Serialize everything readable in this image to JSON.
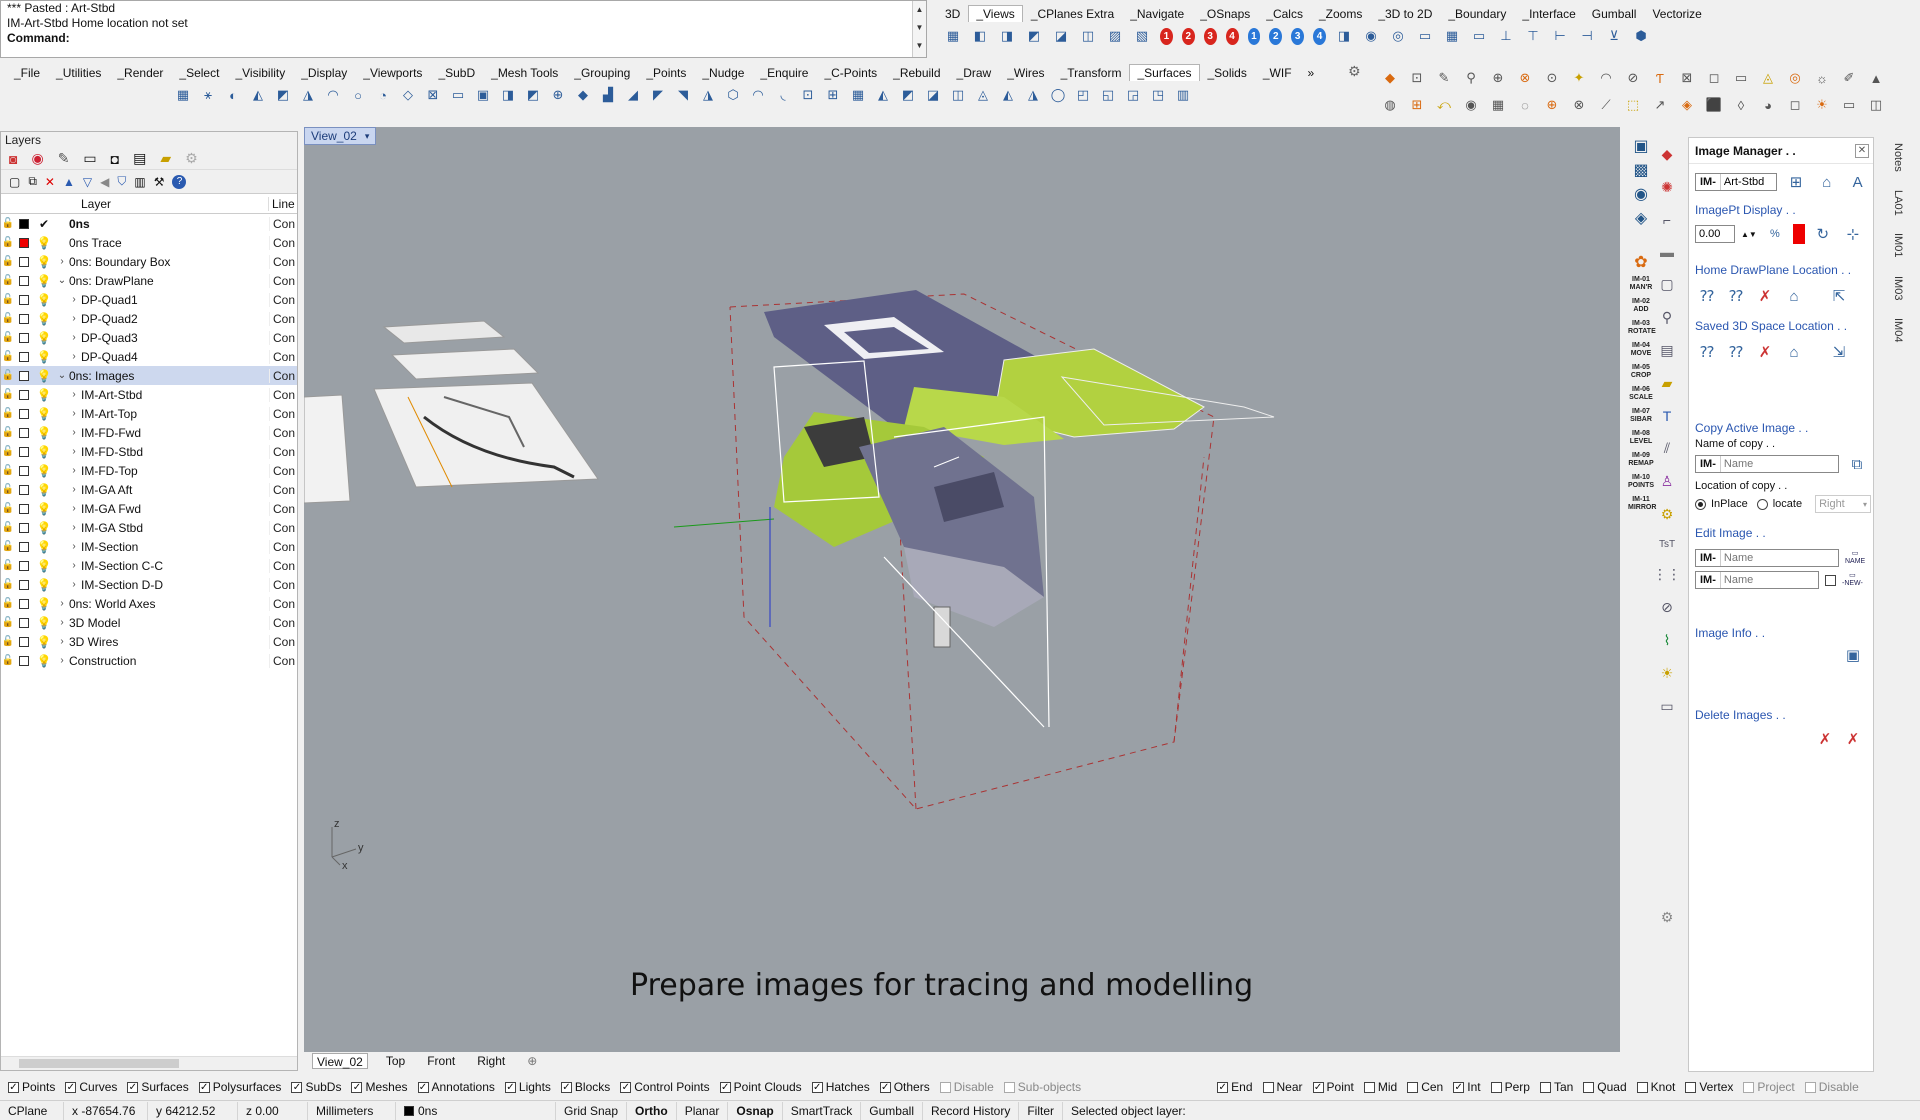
{
  "command": {
    "history": [
      "*** Pasted : Art-Stbd",
      "IM-Art-Stbd Home location not set"
    ],
    "prompt_label": "Command:",
    "value": ""
  },
  "top_tabs": [
    "3D",
    "_Views",
    "_CPlanes Extra",
    "_Navigate",
    "_OSnaps",
    "_Calcs",
    "_Zooms",
    "_3D to 2D",
    "_Boundary",
    "_Interface",
    "Gumball",
    "Vectorize"
  ],
  "top_tabs_active": "_Views",
  "main_tabs": [
    "_File",
    "_Utilities",
    "_Render",
    "_Select",
    "_Visibility",
    "_Display",
    "_Viewports",
    "_SubD",
    "_Mesh Tools",
    "_Grouping",
    "_Points",
    "_Nudge",
    "_Enquire",
    "_C-Points",
    "_Rebuild",
    "_Draw",
    "_Wires",
    "_Transform",
    "_Surfaces",
    "_Solids",
    "_WIF"
  ],
  "main_tabs_active": "_Surfaces",
  "main_tabs_overflow": "»",
  "views_numbers_red": [
    "1",
    "2",
    "3",
    "4"
  ],
  "views_numbers_blue": [
    "1",
    "2",
    "3",
    "4"
  ],
  "layers": {
    "title": "Layers",
    "col_layer": "Layer",
    "col_line": "Line",
    "rows": [
      {
        "name": "0ns",
        "indent": 0,
        "expand": "",
        "bold": true,
        "current": true,
        "color": "#000000",
        "linetype": "Con"
      },
      {
        "name": "0ns Trace",
        "indent": 0,
        "expand": "",
        "color": "#ee0000",
        "linetype": "Con"
      },
      {
        "name": "0ns: Boundary Box",
        "indent": 0,
        "expand": ">",
        "color": "#ffffff",
        "linetype": "Con"
      },
      {
        "name": "0ns: DrawPlane",
        "indent": 0,
        "expand": "v",
        "color": "#ffffff",
        "linetype": "Con"
      },
      {
        "name": "DP-Quad1",
        "indent": 1,
        "expand": ">",
        "color": "#ffffff",
        "linetype": "Con"
      },
      {
        "name": "DP-Quad2",
        "indent": 1,
        "expand": ">",
        "color": "#ffffff",
        "linetype": "Con"
      },
      {
        "name": "DP-Quad3",
        "indent": 1,
        "expand": ">",
        "color": "#ffffff",
        "linetype": "Con"
      },
      {
        "name": "DP-Quad4",
        "indent": 1,
        "expand": ">",
        "color": "#ffffff",
        "linetype": "Con"
      },
      {
        "name": "0ns: Images",
        "indent": 0,
        "expand": "v",
        "selected": true,
        "color": "#ffffff",
        "linetype": "Con"
      },
      {
        "name": "IM-Art-Stbd",
        "indent": 1,
        "expand": ">",
        "color": "#ffffff",
        "linetype": "Con"
      },
      {
        "name": "IM-Art-Top",
        "indent": 1,
        "expand": ">",
        "color": "#ffffff",
        "linetype": "Con"
      },
      {
        "name": "IM-FD-Fwd",
        "indent": 1,
        "expand": ">",
        "color": "#ffffff",
        "linetype": "Con"
      },
      {
        "name": "IM-FD-Stbd",
        "indent": 1,
        "expand": ">",
        "color": "#ffffff",
        "linetype": "Con"
      },
      {
        "name": "IM-FD-Top",
        "indent": 1,
        "expand": ">",
        "color": "#ffffff",
        "linetype": "Con"
      },
      {
        "name": "IM-GA Aft",
        "indent": 1,
        "expand": ">",
        "color": "#ffffff",
        "linetype": "Con"
      },
      {
        "name": "IM-GA Fwd",
        "indent": 1,
        "expand": ">",
        "color": "#ffffff",
        "linetype": "Con"
      },
      {
        "name": "IM-GA Stbd",
        "indent": 1,
        "expand": ">",
        "color": "#ffffff",
        "linetype": "Con"
      },
      {
        "name": "IM-Section",
        "indent": 1,
        "expand": ">",
        "color": "#ffffff",
        "linetype": "Con"
      },
      {
        "name": "IM-Section C-C",
        "indent": 1,
        "expand": ">",
        "color": "#ffffff",
        "linetype": "Con"
      },
      {
        "name": "IM-Section D-D",
        "indent": 1,
        "expand": ">",
        "color": "#ffffff",
        "linetype": "Con"
      },
      {
        "name": "0ns: World Axes",
        "indent": 0,
        "expand": ">",
        "color": "#ffffff",
        "linetype": "Con"
      },
      {
        "name": "3D Model",
        "indent": 0,
        "expand": ">",
        "color": "#ffffff",
        "linetype": "Con"
      },
      {
        "name": "3D Wires",
        "indent": 0,
        "expand": ">",
        "color": "#ffffff",
        "linetype": "Con"
      },
      {
        "name": "Construction",
        "indent": 0,
        "expand": ">",
        "color": "#ffffff",
        "linetype": "Con"
      }
    ]
  },
  "viewport": {
    "tab_label": "View_02",
    "caption": "Prepare images for tracing and modelling",
    "axis_z": "z",
    "axis_y": "y",
    "axis_x": "x",
    "bottom_tabs": [
      "View_02",
      "Top",
      "Front",
      "Right"
    ],
    "bottom_tab_active": "View_02",
    "add_tab": "⊕"
  },
  "im_strip": [
    "IM-01 MAN'R",
    "IM-02 ADD",
    "IM-03 ROTATE",
    "IM-04 MOVE",
    "IM-05 CROP",
    "IM-06 SCALE",
    "IM-07 SIBAR",
    "IM-08 LEVEL",
    "IM-09 REMAP",
    "IM-10 POINTS",
    "IM-11 MIRROR"
  ],
  "image_manager": {
    "title": "Image Manager . .",
    "prefix": "IM-",
    "current_image": "Art-Stbd",
    "sect_display": "ImagePt Display . .",
    "display_value": "0.00",
    "display_color": "#ee0000",
    "sect_home": "Home DrawPlane Location . .",
    "sect_saved": "Saved 3D Space Location . .",
    "sect_copy": "Copy Active Image . .",
    "copy_name_label": "Name of copy . .",
    "copy_name_placeholder": "Name",
    "copy_location_label": "Location of copy . .",
    "opt_inplace": "InPlace",
    "opt_locate": "locate",
    "locate_select": "Right",
    "sect_edit": "Edit Image . .",
    "edit_name_placeholder": "Name",
    "edit_new_placeholder": "Name",
    "btn_name": "NAME",
    "btn_new": "-NEW-",
    "sect_info": "Image Info . .",
    "sect_delete": "Delete Images . ."
  },
  "right_tabs": [
    "Notes",
    "LA01",
    "IM01",
    "IM03",
    "IM04"
  ],
  "filters": [
    {
      "label": "Points",
      "checked": true
    },
    {
      "label": "Curves",
      "checked": true
    },
    {
      "label": "Surfaces",
      "checked": true
    },
    {
      "label": "Polysurfaces",
      "checked": true
    },
    {
      "label": "SubDs",
      "checked": true
    },
    {
      "label": "Meshes",
      "checked": true
    },
    {
      "label": "Annotations",
      "checked": true
    },
    {
      "label": "Lights",
      "checked": true
    },
    {
      "label": "Blocks",
      "checked": true
    },
    {
      "label": "Control Points",
      "checked": true
    },
    {
      "label": "Point Clouds",
      "checked": true
    },
    {
      "label": "Hatches",
      "checked": true
    },
    {
      "label": "Others",
      "checked": true
    },
    {
      "label": "Disable",
      "checked": false,
      "disabled": true
    },
    {
      "label": "Sub-objects",
      "checked": false,
      "disabled": true
    }
  ],
  "osnaps": [
    {
      "label": "End",
      "checked": true
    },
    {
      "label": "Near",
      "checked": false
    },
    {
      "label": "Point",
      "checked": true
    },
    {
      "label": "Mid",
      "checked": false
    },
    {
      "label": "Cen",
      "checked": false
    },
    {
      "label": "Int",
      "checked": true
    },
    {
      "label": "Perp",
      "checked": false
    },
    {
      "label": "Tan",
      "checked": false
    },
    {
      "label": "Quad",
      "checked": false
    },
    {
      "label": "Knot",
      "checked": false
    },
    {
      "label": "Vertex",
      "checked": false
    },
    {
      "label": "Project",
      "checked": false,
      "disabled": true
    },
    {
      "label": "Disable",
      "checked": false,
      "disabled": true
    }
  ],
  "status": {
    "cplane": "CPlane",
    "x": "x -87654.76",
    "y": "y 64212.52",
    "z": "z 0.00",
    "units": "Millimeters",
    "layer": "0ns",
    "layer_color": "#000000",
    "toggles": [
      {
        "label": "Grid Snap",
        "on": false
      },
      {
        "label": "Ortho",
        "on": true
      },
      {
        "label": "Planar",
        "on": false
      },
      {
        "label": "Osnap",
        "on": true
      },
      {
        "label": "SmartTrack",
        "on": false
      },
      {
        "label": "Gumball",
        "on": false
      },
      {
        "label": "Record History",
        "on": false
      },
      {
        "label": "Filter",
        "on": false
      }
    ],
    "message": "Selected object layer:"
  }
}
